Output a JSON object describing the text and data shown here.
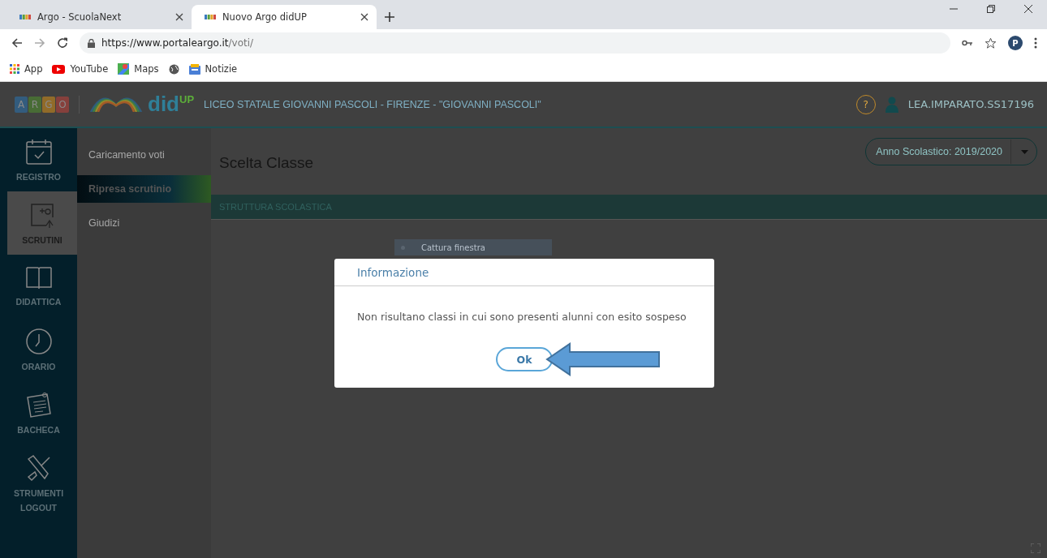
{
  "browser": {
    "tabs": [
      {
        "title": "Argo - ScuolaNext",
        "selected": false
      },
      {
        "title": "Nuovo Argo didUP",
        "selected": true
      }
    ],
    "url_host": "https://www.portaleargo.it",
    "url_path": "/voti/",
    "profile_initial": "P",
    "bookmarks": [
      {
        "label": "App",
        "kind": "apps"
      },
      {
        "label": "YouTube",
        "kind": "youtube"
      },
      {
        "label": "Maps",
        "kind": "maps"
      },
      {
        "kind": "globe"
      },
      {
        "label": "Notizie",
        "kind": "news"
      }
    ]
  },
  "header": {
    "logo_letters": [
      "A",
      "R",
      "G",
      "O"
    ],
    "product": "did",
    "product_sup": "UP",
    "school": "LICEO STATALE GIOVANNI PASCOLI - FIRENZE - \"GIOVANNI PASCOLI\"",
    "help": "?",
    "user": "LEA.IMPARATO.SS17196"
  },
  "nav": [
    {
      "label": "REGISTRO",
      "kind": "calendar",
      "selected": false
    },
    {
      "label": "SCRUTINI",
      "kind": "grades",
      "selected": true
    },
    {
      "label": "DIDATTICA",
      "kind": "book",
      "selected": false
    },
    {
      "label": "ORARIO",
      "kind": "clock",
      "selected": false
    },
    {
      "label": "BACHECA",
      "kind": "board",
      "selected": false
    },
    {
      "label": "STRUMENTI",
      "kind": "tools",
      "selected": false
    },
    {
      "label": "LOGOUT",
      "kind": "text",
      "selected": false
    }
  ],
  "submenu": [
    {
      "label": "Caricamento voti",
      "selected": false
    },
    {
      "label": "Ripresa scrutinio",
      "selected": true
    },
    {
      "label": "Giudizi",
      "selected": false
    }
  ],
  "main": {
    "title": "Scelta Classe",
    "year_select": "Anno Scolastico: 2019/2020",
    "section": "STRUTTURA SCOLASTICA",
    "tooltip": "Cattura finestra"
  },
  "dialog": {
    "title": "Informazione",
    "message": "Non risultano classi in cui sono presenti alunni con esito sospeso",
    "button": "Ok"
  }
}
